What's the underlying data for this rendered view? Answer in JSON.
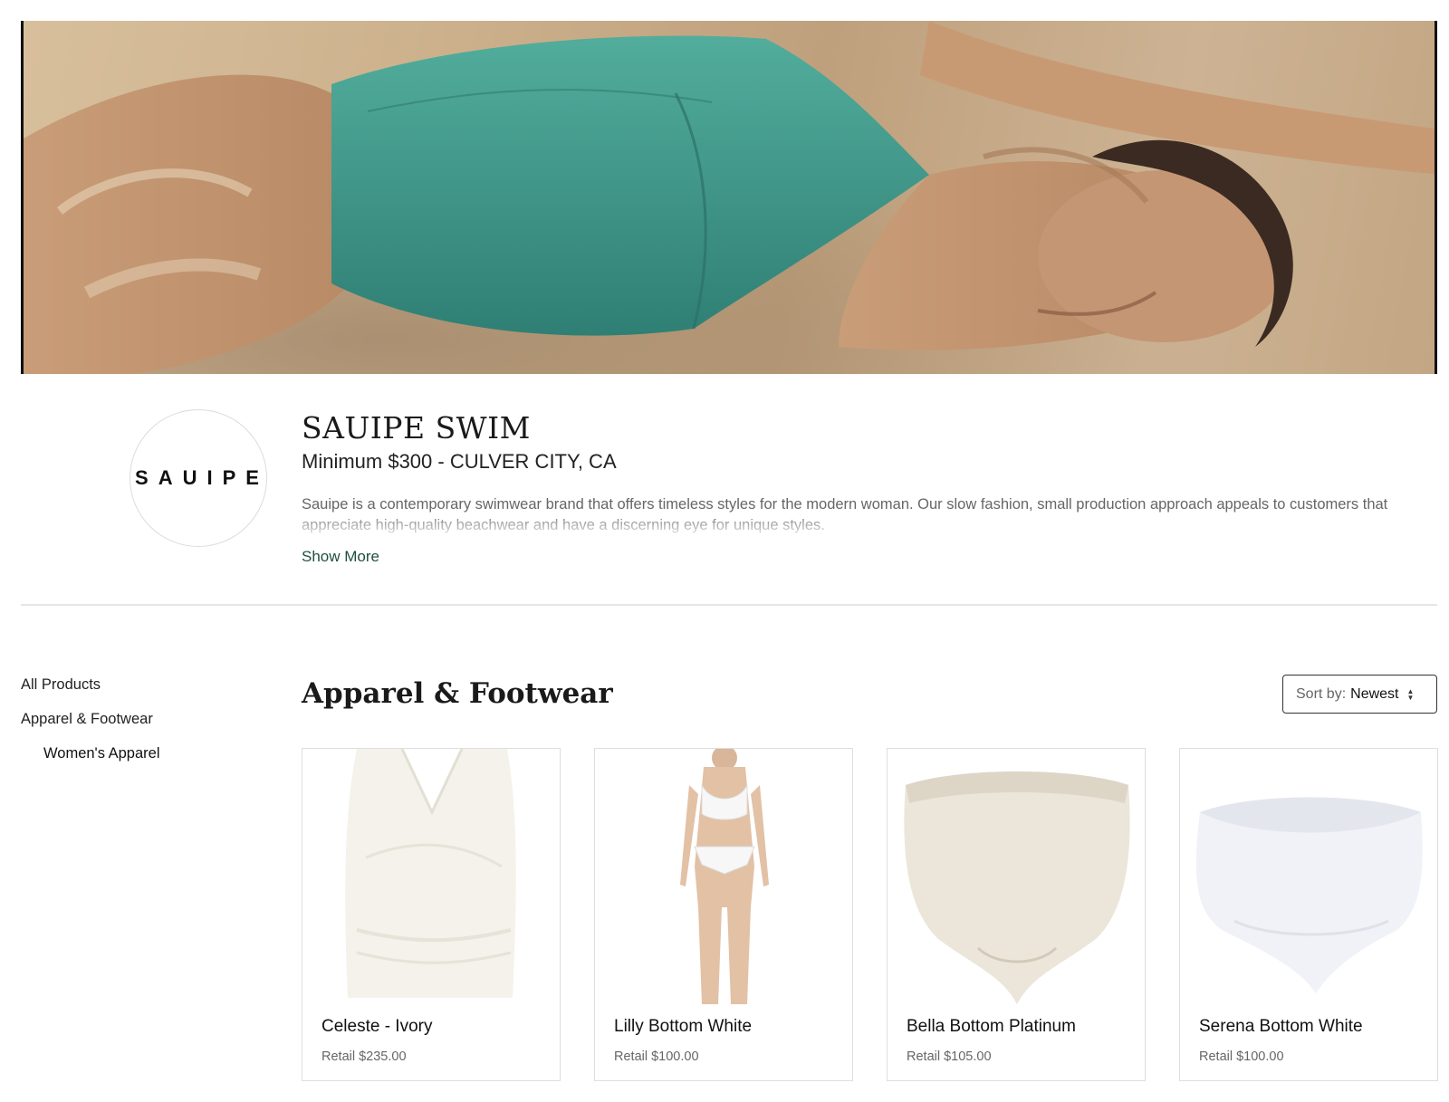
{
  "brand": {
    "logo_text": "SAUIPE",
    "name": "SAUIPE SWIM",
    "meta": "Minimum $300 - CULVER CITY, CA",
    "description": "Sauipe is a contemporary swimwear brand that offers timeless styles for the modern woman. Our slow fashion, small production approach appeals to customers that appreciate high-quality beachwear and have a discerning eye for unique styles.",
    "show_more": "Show More"
  },
  "sidebar": {
    "items": [
      {
        "label": "All Products"
      },
      {
        "label": "Apparel & Footwear"
      },
      {
        "label": "Women's Apparel"
      }
    ]
  },
  "section": {
    "title": "Apparel & Footwear",
    "sort_label": "Sort by:",
    "sort_value": "Newest"
  },
  "products": [
    {
      "name": "Celeste - Ivory",
      "price": "Retail $235.00"
    },
    {
      "name": "Lilly Bottom White",
      "price": "Retail $100.00"
    },
    {
      "name": "Bella Bottom Platinum",
      "price": "Retail $105.00"
    },
    {
      "name": "Serena Bottom White",
      "price": "Retail $100.00"
    }
  ],
  "colors": {
    "accent_link": "#204f3e",
    "swimsuit_teal": "#3e9a8c",
    "sand": "#cbb08b"
  }
}
